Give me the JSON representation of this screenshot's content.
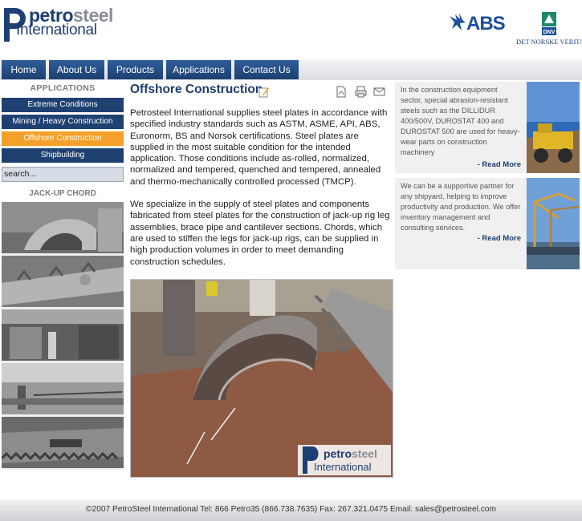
{
  "brand": {
    "logo_top_a": "petro",
    "logo_top_b": "steel",
    "logo_bottom": "International",
    "partner1": "ABS",
    "partner2_caption": "DET NORSKE VERITAS",
    "partner2_badge": "DNV"
  },
  "nav": [
    {
      "label": "Home"
    },
    {
      "label": "About Us"
    },
    {
      "label": "Products"
    },
    {
      "label": "Applications"
    },
    {
      "label": "Contact Us"
    }
  ],
  "sidebar": {
    "heading": "APPLICATIONS",
    "items": [
      {
        "label": "Extreme Conditions"
      },
      {
        "label": "Mining / Heavy Construction"
      },
      {
        "label": "Offshore Construction",
        "active": true
      },
      {
        "label": "Shipbuilding"
      }
    ],
    "search_placeholder": "search...",
    "gallery_heading": "JACK-UP CHORD"
  },
  "main": {
    "title": "Offshore Construction",
    "paragraphs": [
      "Petrosteel International supplies steel plates in accordance with specified industry standards such as ASTM, ASME, API, ABS, Euronorm, BS and Norsok certifications.  Steel plates are supplied in the most suitable condition for the intended application.  Those conditions include as-rolled, normalized, normalized and tempered, quenched and tempered, annealed and thermo-mechanically controlled processed (TMCP).",
      "We specialize in the supply of steel plates and components fabricated from steel plates for the construction of jack-up rig leg assemblies, brace pipe and cantilever sections.  Chords, which are used to stiffen the legs for jack-up rigs, can be supplied in high production volumes in order to meet demanding construction schedules."
    ],
    "photo_logo_a": "petro",
    "photo_logo_b": "steel",
    "photo_logo_c": "International"
  },
  "right": [
    {
      "text": "In the construction equipment sector, special abrasion-resistant steels such as the DILLIDUR 400/500V, DUROSTAT 400 and DUROSTAT 500 are used for heavy-wear parts on construction machinery",
      "link": "- Read More"
    },
    {
      "text": "We can be a supportive partner for any shipyard, helping to improve productivity and production. We offer inventory management and consulting services.",
      "link": "- Read More"
    }
  ],
  "footer": {
    "text": "©2007 PetroSteel International Tel: 866 Petro35 (866.738.7635) Fax: 267.321.0475 Email: sales@petrosteel.com"
  },
  "colors": {
    "navy": "#1f4172",
    "active_orange": "#f5a02a",
    "title_blue": "#1f3e6e"
  }
}
